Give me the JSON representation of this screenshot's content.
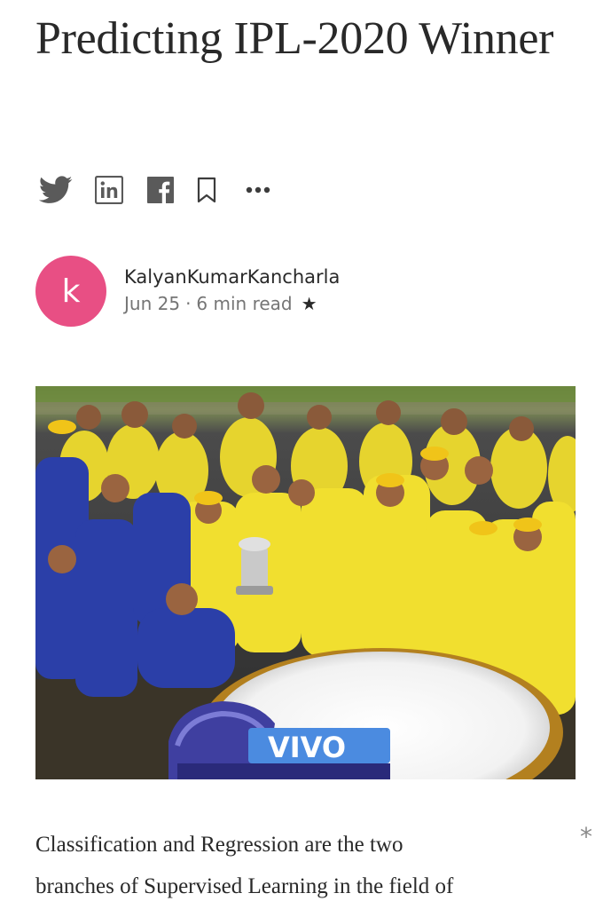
{
  "article": {
    "title": "Predicting IPL-2020 Winner",
    "body_lines": [
      "Classification and Regression are the two",
      "branches of Supervised Learning in the field of"
    ],
    "highlight_marker": "*"
  },
  "author": {
    "avatar_letter": "k",
    "avatar_color": "#e84f84",
    "name": "KalyanKumarKancharla",
    "date": "Jun 25",
    "separator": "·",
    "read_time": "6 min read",
    "member_star": "★"
  },
  "share_icons": [
    "twitter-icon",
    "linkedin-icon",
    "facebook-icon",
    "bookmark-icon",
    "more-options-icon"
  ],
  "hero_image": {
    "description_icon": "team-celebration-photo",
    "jersey_color": "#f4e53b",
    "stage_logo_text": "VIVO"
  }
}
